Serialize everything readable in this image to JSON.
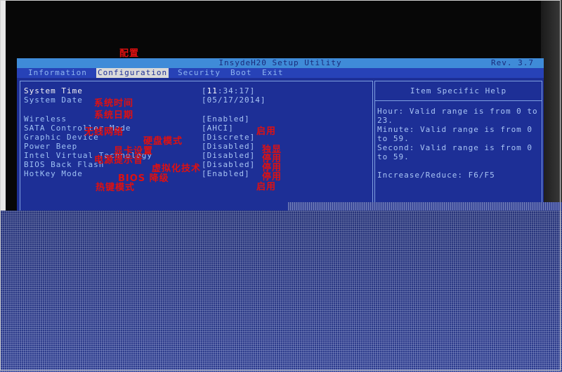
{
  "annotation_top": "配置",
  "window": {
    "title": "InsydeH20 Setup Utility",
    "rev": "Rev. 3.7"
  },
  "menu": {
    "items": [
      {
        "label": "Information"
      },
      {
        "label": "Configuration"
      },
      {
        "label": "Security"
      },
      {
        "label": "Boot"
      },
      {
        "label": "Exit"
      }
    ]
  },
  "settings": {
    "rows": [
      {
        "label": "System Time",
        "value_prefix": "[",
        "value_cursor": "11",
        "value_rest": ":34:17]",
        "note": "系统时间"
      },
      {
        "label": "System Date",
        "value": "[05/17/2014]",
        "note": "系统日期"
      },
      {
        "label": "Wireless",
        "value": "[Enabled]",
        "note": "无线网络",
        "value_note": "启用"
      },
      {
        "label": "SATA Controller Mode",
        "value": "[AHCI]",
        "note": "硬盘模式"
      },
      {
        "label": "Graphic Device",
        "value": "[Discrete]",
        "note": "显卡设置",
        "value_note": "独显"
      },
      {
        "label": "Power Beep",
        "value": "[Disabled]",
        "note": "电源提示音",
        "value_note": "停用"
      },
      {
        "label": "Intel Virtual Technology",
        "value": "[Disabled]",
        "note": "虚拟化技术",
        "value_note": "停用"
      },
      {
        "label": "BIOS Back Flash",
        "value": "[Disabled]",
        "note": "BIOS 降级",
        "value_note": "停用"
      },
      {
        "label": "HotKey Mode",
        "value": "[Enabled]",
        "note": "热键模式",
        "value_note": "启用"
      }
    ]
  },
  "help": {
    "title": "Item Specific Help",
    "lines": [
      "Hour: Valid range is from 0 to",
      "23.",
      "Minute: Valid range is from 0",
      "to 59.",
      "Second: Valid range is from 0",
      "to 59.",
      "",
      "Increase/Reduce: F6/F5"
    ]
  },
  "colors": {
    "bios_background": "#1d2f96",
    "title_bar": "#3f8bd8",
    "menu_active_bg": "#d9d9d9",
    "annotation_red": "#e01010"
  }
}
